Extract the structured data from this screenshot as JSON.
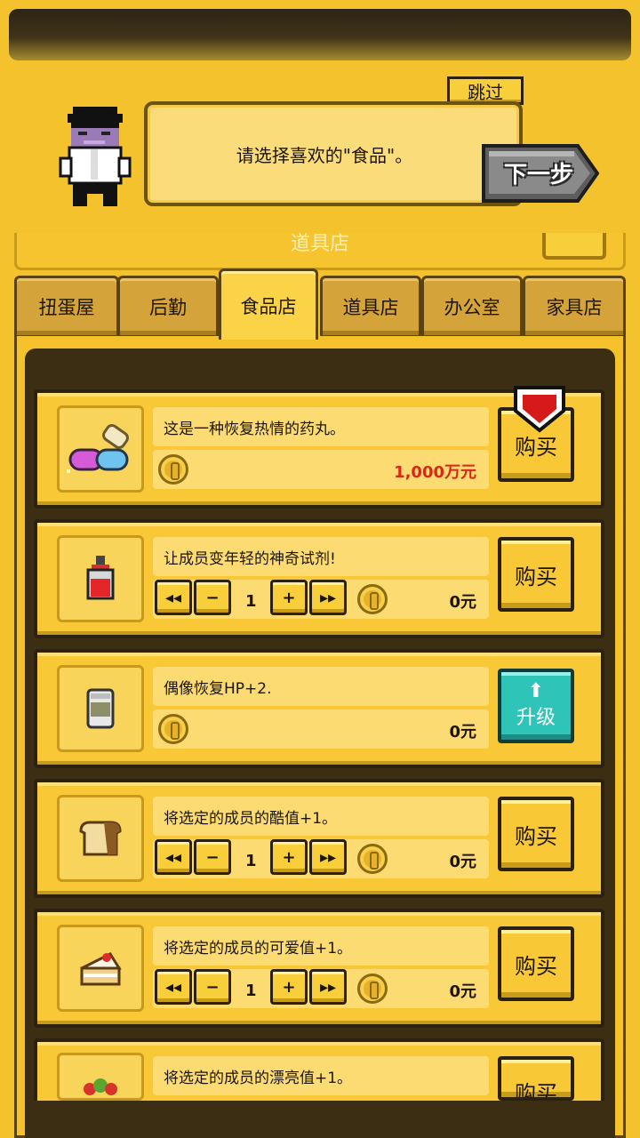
{
  "tutorial": {
    "skip_label": "跳过",
    "message": "请选择喜欢的\"食品\"。",
    "next_label": "下一步",
    "hidden_title": "道具店"
  },
  "tabs": [
    {
      "label": "扭蛋屋"
    },
    {
      "label": "后勤"
    },
    {
      "label": "食品店",
      "active": true
    },
    {
      "label": "道具店"
    },
    {
      "label": "办公室"
    },
    {
      "label": "家具店"
    }
  ],
  "items": [
    {
      "icon": "pill-icon",
      "description": "这是一种恢复热情的药丸。",
      "price": "1,000万元",
      "action": "购买",
      "has_stepper": false
    },
    {
      "icon": "potion-icon",
      "description": "让成员变年轻的神奇试剂!",
      "quantity": "1",
      "price": "0元",
      "action": "购买",
      "has_stepper": true
    },
    {
      "icon": "drink-can-icon",
      "description": "偶像恢复HP+2.",
      "price": "0元",
      "action": "升级",
      "has_stepper": false
    },
    {
      "icon": "bread-icon",
      "description": "将选定的成员的酷值+1。",
      "quantity": "1",
      "price": "0元",
      "action": "购买",
      "has_stepper": true
    },
    {
      "icon": "cake-icon",
      "description": "将选定的成员的可爱值+1。",
      "quantity": "1",
      "price": "0元",
      "action": "购买",
      "has_stepper": true
    },
    {
      "icon": "fruit-bowl-icon",
      "description": "将选定的成员的漂亮值+1。",
      "action": "购买",
      "has_stepper": true
    }
  ],
  "stepper": {
    "min": "◂◂",
    "minus": "−",
    "plus": "+",
    "max": "▸▸"
  },
  "colors": {
    "background": "#f3c22c",
    "price_highlight": "#d9281a",
    "upgrade": "#2fc4b8"
  }
}
